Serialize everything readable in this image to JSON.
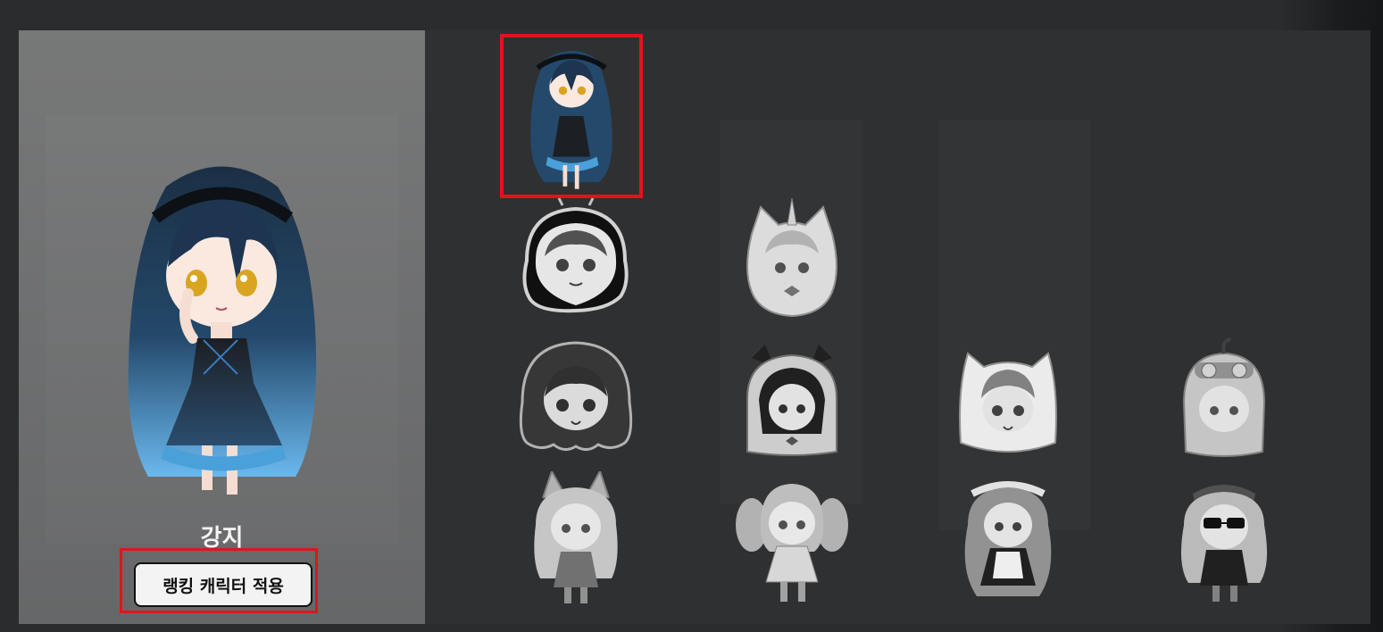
{
  "selected_character": {
    "name": "강지",
    "apply_button_label": "랭킹 캐릭터 적용"
  },
  "character_grid": [
    {
      "id": "gangji",
      "state": "selected",
      "icon": "chibi-blue-hair-girl"
    },
    {
      "id": "ghost-hood-girl",
      "state": "locked",
      "icon": "chibi-ghost-hood-girl"
    },
    {
      "id": "unicorn-hood-girl",
      "state": "locked",
      "icon": "chibi-unicorn-hood-girl"
    },
    {
      "id": "dark-slime-girl",
      "state": "locked",
      "icon": "chibi-dark-slime-girl"
    },
    {
      "id": "bow-ghost-girl",
      "state": "locked",
      "icon": "chibi-bow-ghost-girl"
    },
    {
      "id": "cat-ghost-girl",
      "state": "locked",
      "icon": "chibi-cat-ghost-girl"
    },
    {
      "id": "goggles-girl",
      "state": "locked",
      "icon": "chibi-goggles-girl"
    },
    {
      "id": "fox-ear-girl",
      "state": "locked",
      "icon": "chibi-fox-ear-girl"
    },
    {
      "id": "twin-tail-girl",
      "state": "locked",
      "icon": "chibi-twin-tail-girl"
    },
    {
      "id": "maid-girl",
      "state": "locked",
      "icon": "chibi-maid-girl"
    },
    {
      "id": "sunglasses-girl",
      "state": "locked",
      "icon": "chibi-sunglasses-girl"
    }
  ],
  "colors": {
    "highlight": "#e0141c",
    "hair_dark": "#1f3b57",
    "hair_light": "#5aaee6",
    "eye": "#d9a520"
  }
}
